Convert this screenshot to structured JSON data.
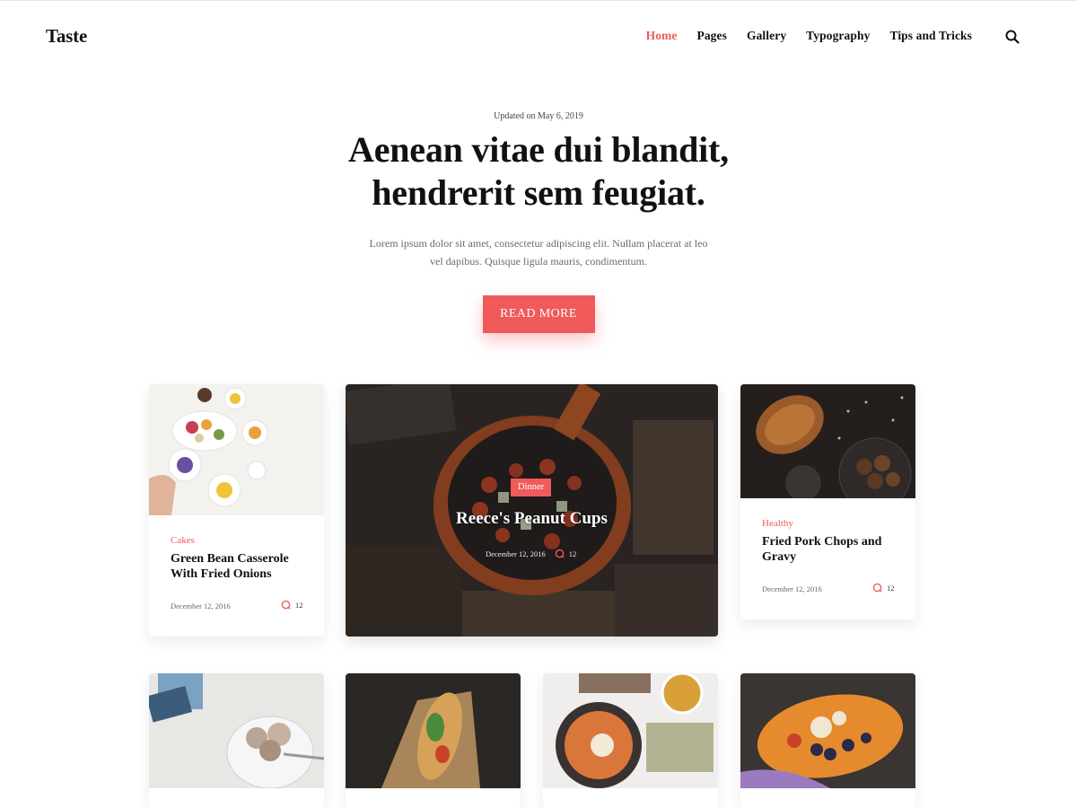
{
  "header": {
    "logo": "Taste",
    "nav": [
      "Home",
      "Pages",
      "Gallery",
      "Typography",
      "Tips and Tricks"
    ],
    "active_nav": "Home",
    "search_icon": "search-icon"
  },
  "hero": {
    "updated": "Updated on May 6, 2019",
    "title_line1": "Aenean vitae dui blandit,",
    "title_line2": "hendrerit sem feugiat.",
    "subtitle": "Lorem ipsum dolor sit amet, consectetur adipiscing elit. Nullam placerat at leo vel dapibus. Quisque ligula mauris, condimentum.",
    "button": "READ MORE"
  },
  "cards": [
    {
      "category": "Cakes",
      "title": "Green Bean Casserole With Fried Onions",
      "date": "December 12, 2016",
      "comments": "12"
    },
    {
      "category": "Dinner",
      "title": "Reece's Peanut Cups",
      "date": "December 12, 2016",
      "comments": "12"
    },
    {
      "category": "Healthy",
      "title": "Fried Pork Chops and Gravy",
      "date": "December 12, 2016",
      "comments": "12"
    }
  ],
  "colors": {
    "accent": "#ef5a5a",
    "text": "#111111",
    "muted": "#6b6b6b"
  }
}
